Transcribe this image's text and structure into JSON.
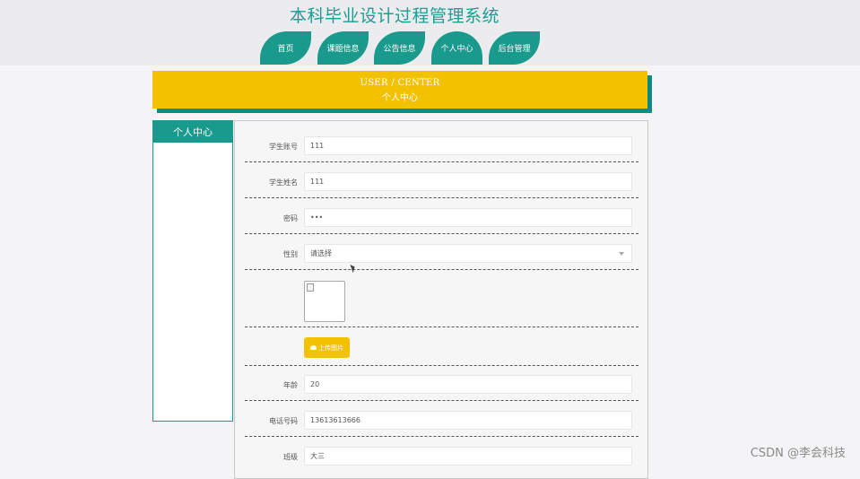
{
  "app": {
    "title": "本科毕业设计过程管理系统"
  },
  "nav": [
    {
      "label": "首页",
      "active": false
    },
    {
      "label": "课题信息",
      "active": false
    },
    {
      "label": "公告信息",
      "active": false
    },
    {
      "label": "个人中心",
      "active": true
    },
    {
      "label": "后台管理",
      "active": false
    }
  ],
  "banner": {
    "en": "USER / CENTER",
    "cn": "个人中心"
  },
  "sidebar": {
    "title": "个人中心"
  },
  "form": {
    "account_label": "学生账号",
    "account_value": "111",
    "name_label": "学生姓名",
    "name_value": "111",
    "password_label": "密码",
    "password_value": "•••",
    "gender_label": "性别",
    "gender_placeholder": "请选择",
    "upload_label": "上传图片",
    "age_label": "年龄",
    "age_value": "20",
    "phone_label": "电话号码",
    "phone_value": "13613613666",
    "class_label": "班级",
    "class_value": "大三"
  },
  "watermark": "CSDN @李会科技",
  "colors": {
    "teal": "#1a9a8d",
    "yellow": "#f2c200"
  },
  "icons": {
    "upload": "cloud-upload-icon",
    "select": "chevron-down-icon",
    "image": "broken-image-icon"
  }
}
